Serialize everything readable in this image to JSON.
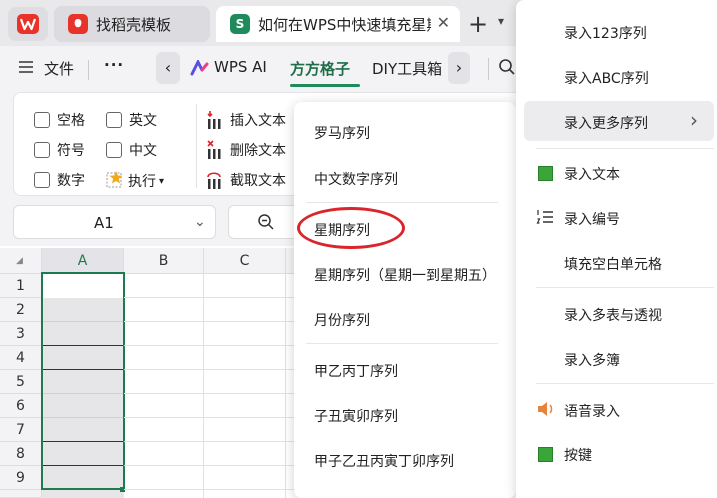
{
  "tabs": {
    "tab1_label": "找稻壳模板",
    "tab2_label": "如何在WPS中快速填充星期",
    "tab2_icon_letter": "S",
    "add_tab": "+"
  },
  "menubar": {
    "file_label": "文件",
    "more_label": "···",
    "wps_ai_label": "WPS AI",
    "fangfang_label": "方方格子",
    "diy_label": "DIY工具箱"
  },
  "ribbon": {
    "checkboxes": [
      "空格",
      "英文",
      "符号",
      "中文",
      "数字"
    ],
    "execute_label": "执行",
    "insert_text_label": "插入文本",
    "delete_text_label": "删除文本",
    "extract_text_label": "截取文本"
  },
  "namebox": {
    "value": "A1"
  },
  "grid": {
    "columns": [
      "A",
      "B",
      "C"
    ],
    "rows": [
      "1",
      "2",
      "3",
      "4",
      "5",
      "6",
      "7",
      "8",
      "9"
    ]
  },
  "submenu": {
    "items": [
      "罗马序列",
      "中文数字序列",
      "星期序列",
      "星期序列（星期一到星期五）",
      "月份序列",
      "甲乙丙丁序列",
      "子丑寅卯序列",
      "甲子乙丑丙寅丁卯序列"
    ],
    "highlighted_item": "星期序列",
    "highlight_color": "#d9252b"
  },
  "rightmenu": {
    "items": [
      "录入123序列",
      "录入ABC序列",
      "录入更多序列",
      "录入文本",
      "录入编号",
      "填充空白单元格",
      "录入多表与透视",
      "录入多簿",
      "语音录入",
      "按键"
    ],
    "more_arrow": "›"
  },
  "colors": {
    "accent_green": "#1f8a5b",
    "selection_border": "#1e7a4f",
    "wps_red": "#e8332a"
  }
}
